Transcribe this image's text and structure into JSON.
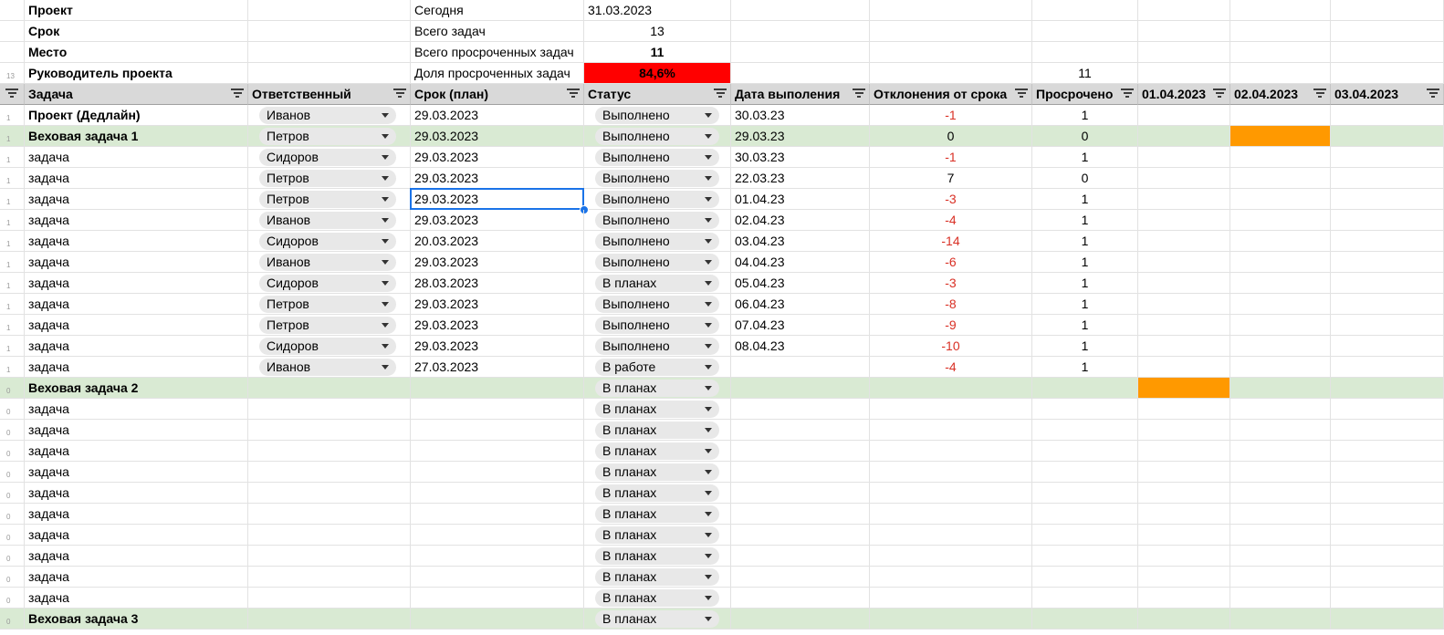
{
  "info": {
    "labels": [
      "Проект",
      "Срок",
      "Место",
      "Руководитель проекта"
    ],
    "gutter_values": [
      "",
      "",
      "",
      "13"
    ],
    "stat_labels": [
      "Сегодня",
      "Всего задач",
      "Всего просроченных задач",
      "Доля просроченных задач"
    ],
    "stat_values": [
      "31.03.2023",
      "13",
      "11",
      "84,6%"
    ],
    "overdue_total": "11"
  },
  "colors": {
    "accent_selection": "#1a73e8",
    "milestone_fill": "#d9ead3",
    "overdue_bar": "#ff9900",
    "alert": "#ff0000",
    "negative_text": "#d93025"
  },
  "headers": [
    "Задача",
    "Ответственный",
    "Срок (план)",
    "Статус",
    "Дата выполения",
    "Отклонения от срока",
    "Просрочено",
    "01.04.2023",
    "02.04.2023",
    "03.04.2023"
  ],
  "rows": [
    {
      "g": "1",
      "task": "Проект (Дедлайн)",
      "bold": true,
      "owner": "Иванов",
      "plan": "29.03.2023",
      "status": "Выполнено",
      "done": "30.03.23",
      "dev": "-1",
      "neg": true,
      "over": "1",
      "green": false,
      "gantt": ""
    },
    {
      "g": "1",
      "task": "Веховая задача 1",
      "bold": true,
      "owner": "Петров",
      "plan": "29.03.2023",
      "status": "Выполнено",
      "done": "29.03.23",
      "dev": "0",
      "neg": false,
      "over": "0",
      "green": true,
      "gantt": "02.04"
    },
    {
      "g": "1",
      "task": "задача",
      "bold": false,
      "owner": "Сидоров",
      "plan": "29.03.2023",
      "status": "Выполнено",
      "done": "30.03.23",
      "dev": "-1",
      "neg": true,
      "over": "1",
      "green": false,
      "gantt": ""
    },
    {
      "g": "1",
      "task": "задача",
      "bold": false,
      "owner": "Петров",
      "plan": "29.03.2023",
      "status": "Выполнено",
      "done": "22.03.23",
      "dev": "7",
      "neg": false,
      "over": "0",
      "green": false,
      "gantt": ""
    },
    {
      "g": "1",
      "task": "задача",
      "bold": false,
      "owner": "Петров",
      "plan": "29.03.2023",
      "status": "Выполнено",
      "done": "01.04.23",
      "dev": "-3",
      "neg": true,
      "over": "1",
      "green": false,
      "gantt": "",
      "selected": true
    },
    {
      "g": "1",
      "task": "задача",
      "bold": false,
      "owner": "Иванов",
      "plan": "29.03.2023",
      "status": "Выполнено",
      "done": "02.04.23",
      "dev": "-4",
      "neg": true,
      "over": "1",
      "green": false,
      "gantt": ""
    },
    {
      "g": "1",
      "task": "задача",
      "bold": false,
      "owner": "Сидоров",
      "plan": "20.03.2023",
      "status": "Выполнено",
      "done": "03.04.23",
      "dev": "-14",
      "neg": true,
      "over": "1",
      "green": false,
      "gantt": ""
    },
    {
      "g": "1",
      "task": "задача",
      "bold": false,
      "owner": "Иванов",
      "plan": "29.03.2023",
      "status": "Выполнено",
      "done": "04.04.23",
      "dev": "-6",
      "neg": true,
      "over": "1",
      "green": false,
      "gantt": ""
    },
    {
      "g": "1",
      "task": "задача",
      "bold": false,
      "owner": "Сидоров",
      "plan": "28.03.2023",
      "status": "В планах",
      "done": "05.04.23",
      "dev": "-3",
      "neg": true,
      "over": "1",
      "green": false,
      "gantt": ""
    },
    {
      "g": "1",
      "task": "задача",
      "bold": false,
      "owner": "Петров",
      "plan": "29.03.2023",
      "status": "Выполнено",
      "done": "06.04.23",
      "dev": "-8",
      "neg": true,
      "over": "1",
      "green": false,
      "gantt": ""
    },
    {
      "g": "1",
      "task": "задача",
      "bold": false,
      "owner": "Петров",
      "plan": "29.03.2023",
      "status": "Выполнено",
      "done": "07.04.23",
      "dev": "-9",
      "neg": true,
      "over": "1",
      "green": false,
      "gantt": ""
    },
    {
      "g": "1",
      "task": "задача",
      "bold": false,
      "owner": "Сидоров",
      "plan": "29.03.2023",
      "status": "Выполнено",
      "done": "08.04.23",
      "dev": "-10",
      "neg": true,
      "over": "1",
      "green": false,
      "gantt": ""
    },
    {
      "g": "1",
      "task": "задача",
      "bold": false,
      "owner": "Иванов",
      "plan": "27.03.2023",
      "status": "В работе",
      "done": "",
      "dev": "-4",
      "neg": true,
      "over": "1",
      "green": false,
      "gantt": ""
    },
    {
      "g": "0",
      "task": "Веховая задача 2",
      "bold": true,
      "owner": "",
      "plan": "",
      "status": "В планах",
      "done": "",
      "dev": "",
      "neg": false,
      "over": "",
      "green": true,
      "gantt": "01.04"
    },
    {
      "g": "0",
      "task": "задача",
      "bold": false,
      "owner": "",
      "plan": "",
      "status": "В планах",
      "done": "",
      "dev": "",
      "neg": false,
      "over": "",
      "green": false,
      "gantt": ""
    },
    {
      "g": "0",
      "task": "задача",
      "bold": false,
      "owner": "",
      "plan": "",
      "status": "В планах",
      "done": "",
      "dev": "",
      "neg": false,
      "over": "",
      "green": false,
      "gantt": ""
    },
    {
      "g": "0",
      "task": "задача",
      "bold": false,
      "owner": "",
      "plan": "",
      "status": "В планах",
      "done": "",
      "dev": "",
      "neg": false,
      "over": "",
      "green": false,
      "gantt": ""
    },
    {
      "g": "0",
      "task": "задача",
      "bold": false,
      "owner": "",
      "plan": "",
      "status": "В планах",
      "done": "",
      "dev": "",
      "neg": false,
      "over": "",
      "green": false,
      "gantt": ""
    },
    {
      "g": "0",
      "task": "задача",
      "bold": false,
      "owner": "",
      "plan": "",
      "status": "В планах",
      "done": "",
      "dev": "",
      "neg": false,
      "over": "",
      "green": false,
      "gantt": ""
    },
    {
      "g": "0",
      "task": "задача",
      "bold": false,
      "owner": "",
      "plan": "",
      "status": "В планах",
      "done": "",
      "dev": "",
      "neg": false,
      "over": "",
      "green": false,
      "gantt": ""
    },
    {
      "g": "0",
      "task": "задача",
      "bold": false,
      "owner": "",
      "plan": "",
      "status": "В планах",
      "done": "",
      "dev": "",
      "neg": false,
      "over": "",
      "green": false,
      "gantt": ""
    },
    {
      "g": "0",
      "task": "задача",
      "bold": false,
      "owner": "",
      "plan": "",
      "status": "В планах",
      "done": "",
      "dev": "",
      "neg": false,
      "over": "",
      "green": false,
      "gantt": ""
    },
    {
      "g": "0",
      "task": "задача",
      "bold": false,
      "owner": "",
      "plan": "",
      "status": "В планах",
      "done": "",
      "dev": "",
      "neg": false,
      "over": "",
      "green": false,
      "gantt": ""
    },
    {
      "g": "0",
      "task": "задача",
      "bold": false,
      "owner": "",
      "plan": "",
      "status": "В планах",
      "done": "",
      "dev": "",
      "neg": false,
      "over": "",
      "green": false,
      "gantt": ""
    },
    {
      "g": "0",
      "task": "Веховая задача 3",
      "bold": true,
      "owner": "",
      "plan": "",
      "status": "В планах",
      "done": "",
      "dev": "",
      "neg": false,
      "over": "",
      "green": true,
      "gantt": ""
    }
  ]
}
